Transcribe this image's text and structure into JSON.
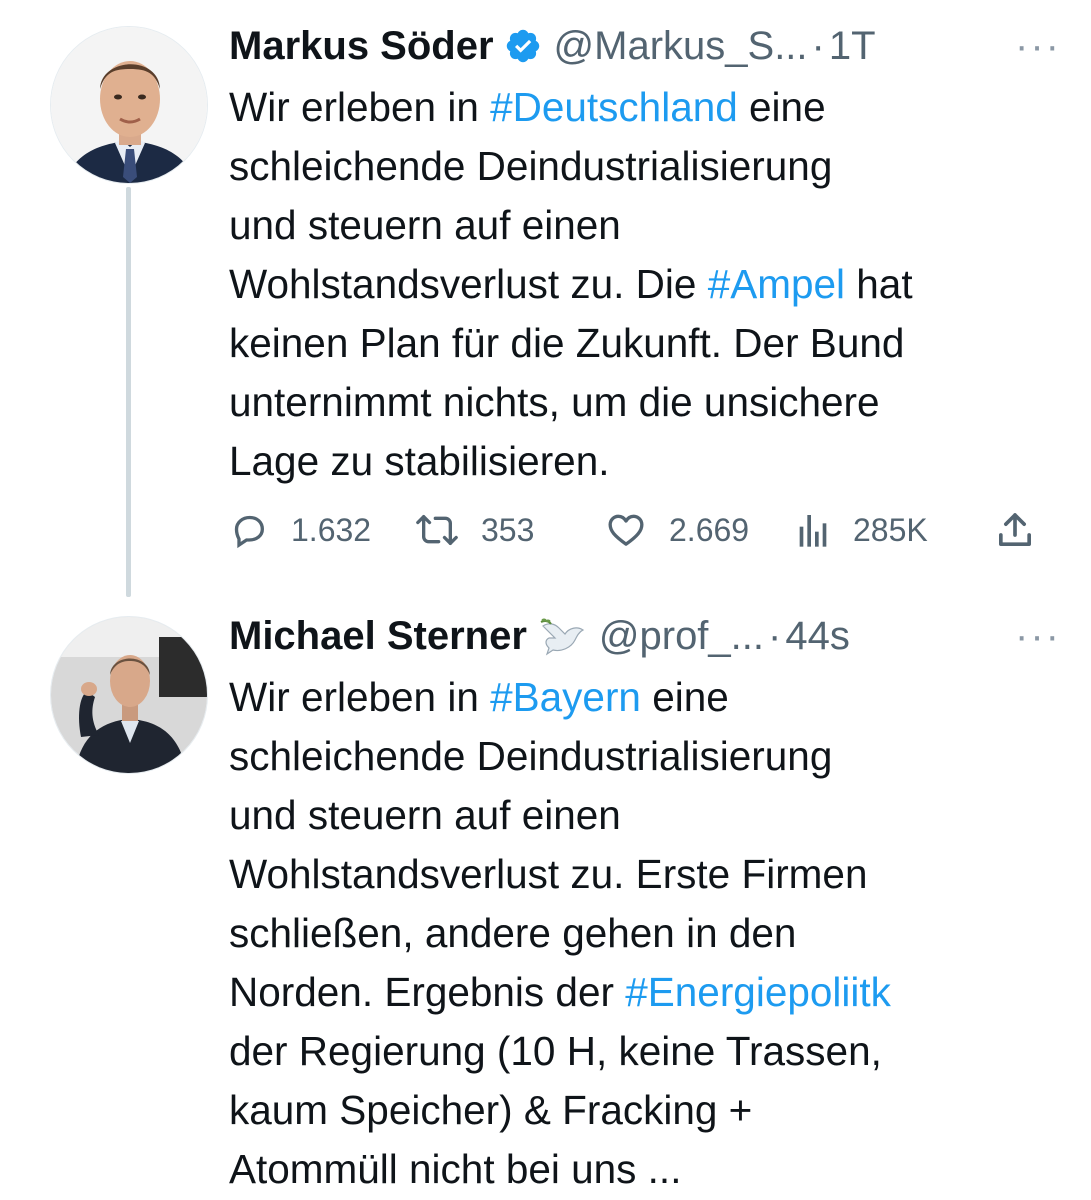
{
  "tweets": [
    {
      "author": {
        "name": "Markus Söder",
        "handle": "@Markus_S...",
        "verified": true,
        "time": "1T"
      },
      "separator": "·",
      "more": "···",
      "lines": [
        [
          {
            "text": "Wir erleben in "
          },
          {
            "text": "#Deutschland",
            "hashtag": true
          },
          {
            "text": " eine"
          }
        ],
        [
          {
            "text": "schleichende Deindustrialisierung"
          }
        ],
        [
          {
            "text": "und steuern auf einen"
          }
        ],
        [
          {
            "text": "Wohlstandsverlust zu. Die "
          },
          {
            "text": "#Ampel",
            "hashtag": true
          },
          {
            "text": " hat"
          }
        ],
        [
          {
            "text": "keinen Plan für die Zukunft. Der Bund"
          }
        ],
        [
          {
            "text": "unternimmt nichts, um die unsichere"
          }
        ],
        [
          {
            "text": "Lage zu stabilisieren."
          }
        ]
      ],
      "actions": {
        "replies": "1.632",
        "retweets": "353",
        "likes": "2.669",
        "views": "285K"
      }
    },
    {
      "author": {
        "name": "Michael Sterner",
        "name_emoji": "dove-icon",
        "handle": "@prof_...",
        "verified": false,
        "time": "44s"
      },
      "separator": "·",
      "more": "···",
      "lines": [
        [
          {
            "text": "Wir erleben in "
          },
          {
            "text": "#Bayern",
            "hashtag": true
          },
          {
            "text": " eine"
          }
        ],
        [
          {
            "text": "schleichende Deindustrialisierung"
          }
        ],
        [
          {
            "text": "und steuern auf einen"
          }
        ],
        [
          {
            "text": "Wohlstandsverlust zu. Erste Firmen"
          }
        ],
        [
          {
            "text": "schließen, andere gehen in den"
          }
        ],
        [
          {
            "text": "Norden. Ergebnis der "
          },
          {
            "text": "#Energiepoliitk",
            "hashtag": true
          }
        ],
        [
          {
            "text": "der Regierung (10 H, keine Trassen,"
          }
        ],
        [
          {
            "text": "kaum Speicher) & Fracking +"
          }
        ],
        [
          {
            "text": "Atommüll nicht bei uns ..."
          }
        ]
      ]
    }
  ],
  "colors": {
    "text": "#0f1419",
    "secondary": "#536471",
    "hashtag": "#1d9bf0",
    "verified": "#1d9bf0",
    "thread_line": "#cfd9de"
  }
}
